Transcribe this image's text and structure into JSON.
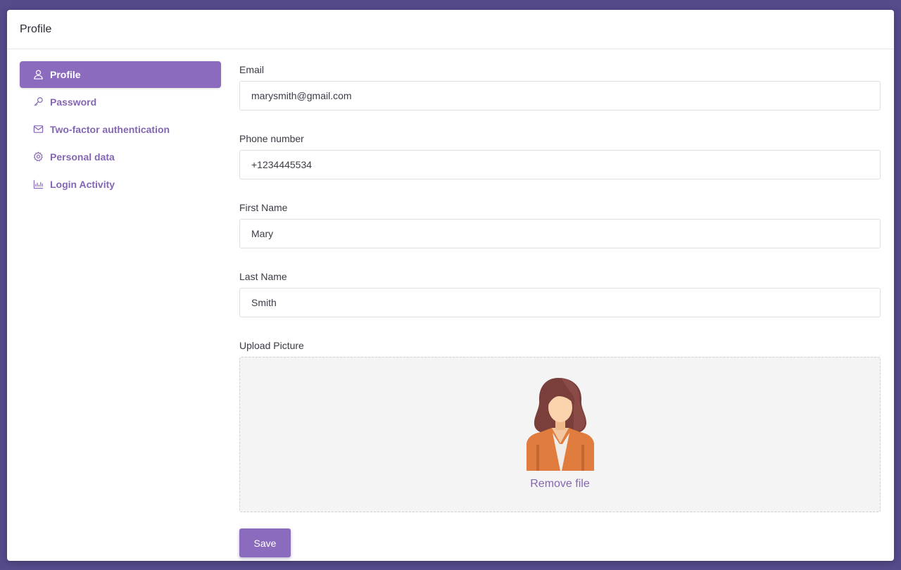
{
  "header": {
    "title": "Profile"
  },
  "sidebar": {
    "items": [
      {
        "label": "Profile",
        "icon": "user-icon",
        "active": true
      },
      {
        "label": "Password",
        "icon": "key-icon",
        "active": false
      },
      {
        "label": "Two-factor authentication",
        "icon": "envelope-icon",
        "active": false
      },
      {
        "label": "Personal data",
        "icon": "gear-icon",
        "active": false
      },
      {
        "label": "Login Activity",
        "icon": "bar-chart-icon",
        "active": false
      }
    ]
  },
  "form": {
    "email": {
      "label": "Email",
      "value": "marysmith@gmail.com"
    },
    "phone": {
      "label": "Phone number",
      "value": "+1234445534"
    },
    "first_name": {
      "label": "First Name",
      "value": "Mary"
    },
    "last_name": {
      "label": "Last Name",
      "value": "Smith"
    },
    "upload": {
      "label": "Upload Picture",
      "remove_label": "Remove file"
    },
    "save_label": "Save"
  },
  "colors": {
    "accent": "#8b6bbd",
    "background": "#554a8a",
    "link": "#8466b3"
  }
}
